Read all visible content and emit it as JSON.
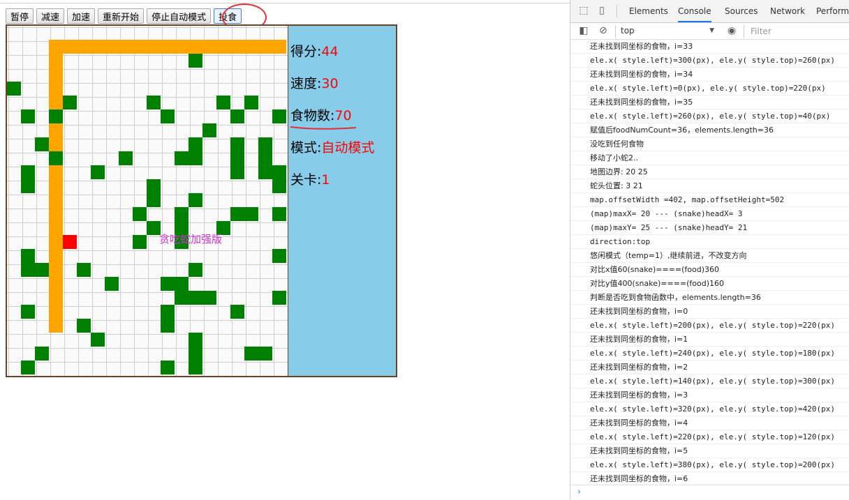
{
  "controls": {
    "pause": "暂停",
    "slow_down": "减速",
    "speed_up": "加速",
    "restart": "重新开始",
    "stop_auto": "停止自动模式",
    "feed": "投食"
  },
  "game": {
    "watermark": "贪吃蛇加强版",
    "colors": {
      "food": "#008000",
      "snake_body": "#ffa500",
      "snake_head": "#ff0000",
      "panel": "#87cdea",
      "map_border": "#6b4423"
    },
    "grid": {
      "cols": 20,
      "rows": 25
    },
    "snake": [
      [
        3,
        21
      ],
      [
        3,
        20
      ],
      [
        3,
        19
      ],
      [
        3,
        18
      ],
      [
        3,
        17
      ],
      [
        3,
        16
      ],
      [
        3,
        15
      ],
      [
        3,
        14
      ],
      [
        3,
        13
      ],
      [
        3,
        12
      ],
      [
        3,
        11
      ],
      [
        3,
        10
      ],
      [
        3,
        9
      ],
      [
        3,
        8
      ],
      [
        3,
        7
      ],
      [
        3,
        6
      ],
      [
        3,
        5
      ],
      [
        3,
        4
      ],
      [
        3,
        3
      ],
      [
        3,
        2
      ],
      [
        3,
        1
      ],
      [
        4,
        1
      ],
      [
        5,
        1
      ],
      [
        6,
        1
      ],
      [
        7,
        1
      ],
      [
        8,
        1
      ],
      [
        9,
        1
      ],
      [
        10,
        1
      ],
      [
        11,
        1
      ],
      [
        12,
        1
      ],
      [
        13,
        1
      ],
      [
        14,
        1
      ],
      [
        15,
        1
      ],
      [
        16,
        1
      ],
      [
        17,
        1
      ],
      [
        18,
        1
      ],
      [
        19,
        1
      ]
    ],
    "head": [
      4,
      15
    ],
    "food": [
      [
        13,
        2
      ],
      [
        0,
        4
      ],
      [
        4,
        5
      ],
      [
        10,
        5
      ],
      [
        15,
        5
      ],
      [
        17,
        5
      ],
      [
        1,
        6
      ],
      [
        3,
        6
      ],
      [
        11,
        6
      ],
      [
        16,
        6
      ],
      [
        19,
        6
      ],
      [
        14,
        7
      ],
      [
        2,
        8
      ],
      [
        13,
        8
      ],
      [
        16,
        8
      ],
      [
        18,
        8
      ],
      [
        3,
        9
      ],
      [
        8,
        9
      ],
      [
        12,
        9
      ],
      [
        13,
        9
      ],
      [
        16,
        9
      ],
      [
        18,
        9
      ],
      [
        1,
        10
      ],
      [
        6,
        10
      ],
      [
        16,
        10
      ],
      [
        18,
        10
      ],
      [
        19,
        10
      ],
      [
        1,
        11
      ],
      [
        10,
        11
      ],
      [
        19,
        11
      ],
      [
        10,
        12
      ],
      [
        13,
        12
      ],
      [
        9,
        13
      ],
      [
        12,
        13
      ],
      [
        16,
        13
      ],
      [
        17,
        13
      ],
      [
        19,
        13
      ],
      [
        10,
        14
      ],
      [
        12,
        14
      ],
      [
        15,
        14
      ],
      [
        9,
        15
      ],
      [
        12,
        15
      ],
      [
        1,
        16
      ],
      [
        19,
        16
      ],
      [
        1,
        17
      ],
      [
        2,
        17
      ],
      [
        5,
        17
      ],
      [
        13,
        17
      ],
      [
        7,
        18
      ],
      [
        11,
        18
      ],
      [
        12,
        18
      ],
      [
        12,
        19
      ],
      [
        13,
        19
      ],
      [
        14,
        19
      ],
      [
        19,
        19
      ],
      [
        1,
        20
      ],
      [
        11,
        20
      ],
      [
        16,
        20
      ],
      [
        5,
        21
      ],
      [
        11,
        21
      ],
      [
        6,
        22
      ],
      [
        13,
        22
      ],
      [
        2,
        23
      ],
      [
        13,
        23
      ],
      [
        17,
        23
      ],
      [
        18,
        23
      ],
      [
        1,
        24
      ],
      [
        11,
        24
      ],
      [
        13,
        24
      ]
    ]
  },
  "panel": {
    "score_label": "得分:",
    "score": "44",
    "speed_label": "速度:",
    "speed": "30",
    "food_label": "食物数:",
    "food_count": "70",
    "mode_label": "模式:",
    "mode": "自动模式",
    "level_label": "关卡:",
    "level": "1"
  },
  "devtools": {
    "tabs": [
      "Elements",
      "Console",
      "Sources",
      "Network",
      "Performa"
    ],
    "active_tab": "Console",
    "context": "top",
    "filter_placeholder": "Filter",
    "logs": [
      "还未找到同坐标的食物，i=33",
      "ele.x( style.left)=300(px), ele.y( style.top)=260(px)",
      "还未找到同坐标的食物，i=34",
      "ele.x( style.left)=0(px), ele.y( style.top)=220(px)",
      "还未找到同坐标的食物，i=35",
      "ele.x( style.left)=260(px), ele.y( style.top)=40(px)",
      "赋值后foodNumCount=36，elements.length=36",
      "没吃到任何食物",
      "移动了小蛇2..",
      "地图边界: 20 25",
      "蛇头位置: 3 21",
      "map.offsetWidth =402, map.offsetHeight=502",
      "(map)maxX= 20 --- (snake)headX= 3",
      "(map)maxY= 25 --- (snake)headY= 21",
      "direction:top",
      "悠闲模式（temp=1）,继续前进，不改变方向",
      "对比x值60(snake)====(food)360",
      "对比y值400(snake)====(food)160",
      "判断是否吃到食物函数中，elements.length=36",
      "还未找到同坐标的食物，i=0",
      "ele.x( style.left)=200(px), ele.y( style.top)=220(px)",
      "还未找到同坐标的食物，i=1",
      "ele.x( style.left)=240(px), ele.y( style.top)=180(px)",
      "还未找到同坐标的食物，i=2",
      "ele.x( style.left)=140(px), ele.y( style.top)=300(px)",
      "还未找到同坐标的食物，i=3",
      "ele.x( style.left)=320(px), ele.y( style.top)=420(px)",
      "还未找到同坐标的食物，i=4",
      "ele.x( style.left)=220(px), ele.y( style.top)=120(px)",
      "还未找到同坐标的食物，i=5",
      "ele.x( style.left)=380(px), ele.y( style.top)=200(px)",
      "还未找到同坐标的食物，i=6"
    ]
  }
}
